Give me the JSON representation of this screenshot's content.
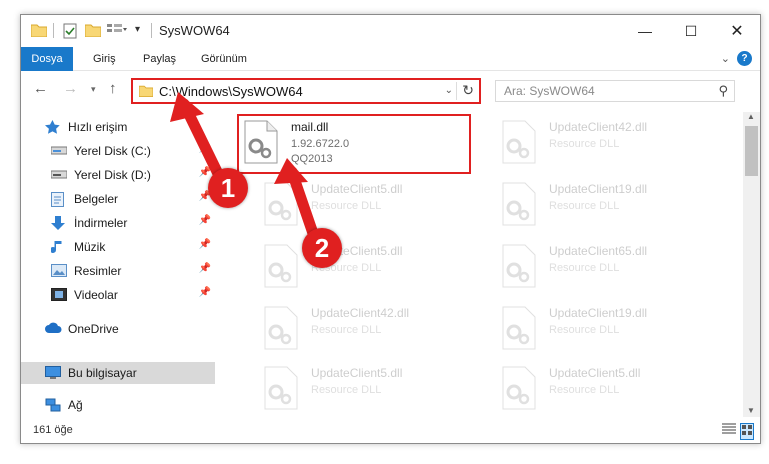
{
  "window": {
    "title": "SysWOW64"
  },
  "ribbon": {
    "tabs": [
      "Dosya",
      "Giriş",
      "Paylaş",
      "Görünüm"
    ]
  },
  "address": {
    "path": "C:\\Windows\\SysWOW64"
  },
  "search": {
    "placeholder": "Ara: SysWOW64"
  },
  "sidebar": {
    "items": [
      {
        "label": "Hızlı erişim",
        "icon": "star-icon",
        "pinned": false
      },
      {
        "label": "Yerel Disk (C:)",
        "icon": "drive-icon",
        "pinned": true
      },
      {
        "label": "Yerel Disk (D:)",
        "icon": "drive-icon",
        "pinned": true
      },
      {
        "label": "Belgeler",
        "icon": "documents-icon",
        "pinned": true
      },
      {
        "label": "İndirmeler",
        "icon": "download-icon",
        "pinned": true
      },
      {
        "label": "Müzik",
        "icon": "music-icon",
        "pinned": true
      },
      {
        "label": "Resimler",
        "icon": "pictures-icon",
        "pinned": true
      },
      {
        "label": "Videolar",
        "icon": "videos-icon",
        "pinned": true
      },
      {
        "label": "OneDrive",
        "icon": "cloud-icon",
        "pinned": false
      },
      {
        "label": "Bu bilgisayar",
        "icon": "computer-icon",
        "pinned": false
      },
      {
        "label": "Ağ",
        "icon": "network-icon",
        "pinned": false
      }
    ]
  },
  "files": {
    "highlighted": {
      "name": "mail.dll",
      "version": "1.92.6722.0",
      "company": "QQ2013"
    },
    "ghost": [
      {
        "name": "UpdateClient42.dll",
        "desc": "Resource DLL"
      },
      {
        "name": "UpdateClient5.dll",
        "desc": "Resource DLL"
      },
      {
        "name": "UpdateClient19.dll",
        "desc": "Resource DLL"
      },
      {
        "name": "UpdateClient5.dll",
        "desc": "Resource DLL"
      },
      {
        "name": "UpdateClient65.dll",
        "desc": "Resource DLL"
      },
      {
        "name": "UpdateClient42.dll",
        "desc": "Resource DLL"
      },
      {
        "name": "UpdateClient19.dll",
        "desc": "Resource DLL"
      },
      {
        "name": "UpdateClient5.dll",
        "desc": "Resource DLL"
      },
      {
        "name": "UpdateClient5.dll",
        "desc": "Resource DLL"
      }
    ]
  },
  "status": {
    "count": "161 öğe"
  },
  "annotations": {
    "step1": "1",
    "step2": "2",
    "color": "#e02020"
  }
}
